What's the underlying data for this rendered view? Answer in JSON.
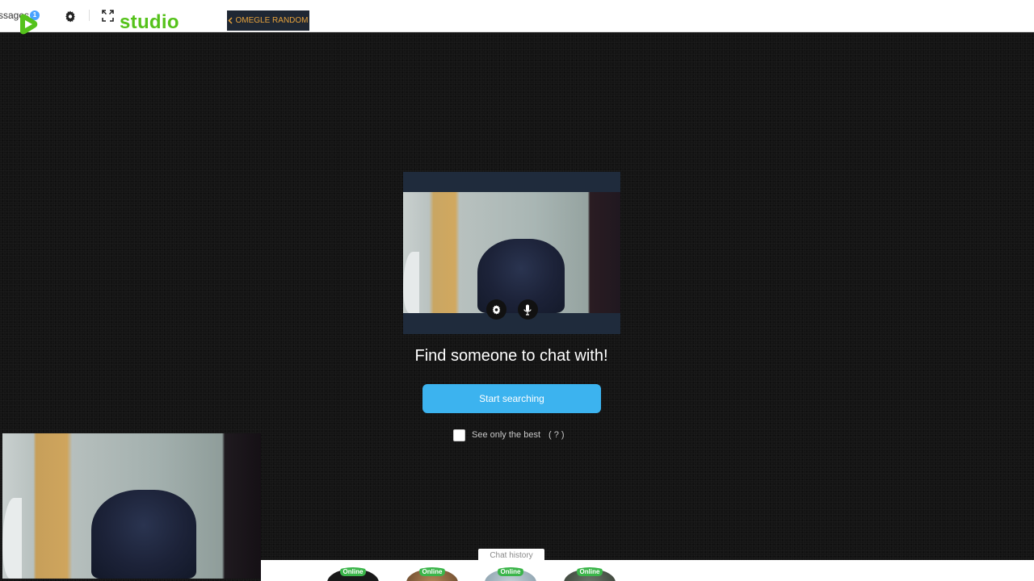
{
  "header": {
    "messages_label": "ssages",
    "messages_count": "1",
    "brand": "studio",
    "mode_button": "OMEGLE RANDOM",
    "brand_color": "#55c21b"
  },
  "icons": {
    "logo": "play-logo-icon",
    "settings": "gear-icon",
    "fullscreen": "expand-icon",
    "back": "chevron-left-icon",
    "camera_settings": "gear-icon",
    "microphone": "microphone-icon"
  },
  "main": {
    "headline": "Find someone to chat with!",
    "start_button": "Start searching",
    "best_label": "See only the best",
    "best_help": "( ? )",
    "accent_color": "#3cb3ef"
  },
  "footer": {
    "history_tab": "Chat history",
    "contacts": [
      {
        "status": "Online"
      },
      {
        "status": "Online"
      },
      {
        "status": "Online"
      },
      {
        "status": "Online"
      }
    ]
  }
}
